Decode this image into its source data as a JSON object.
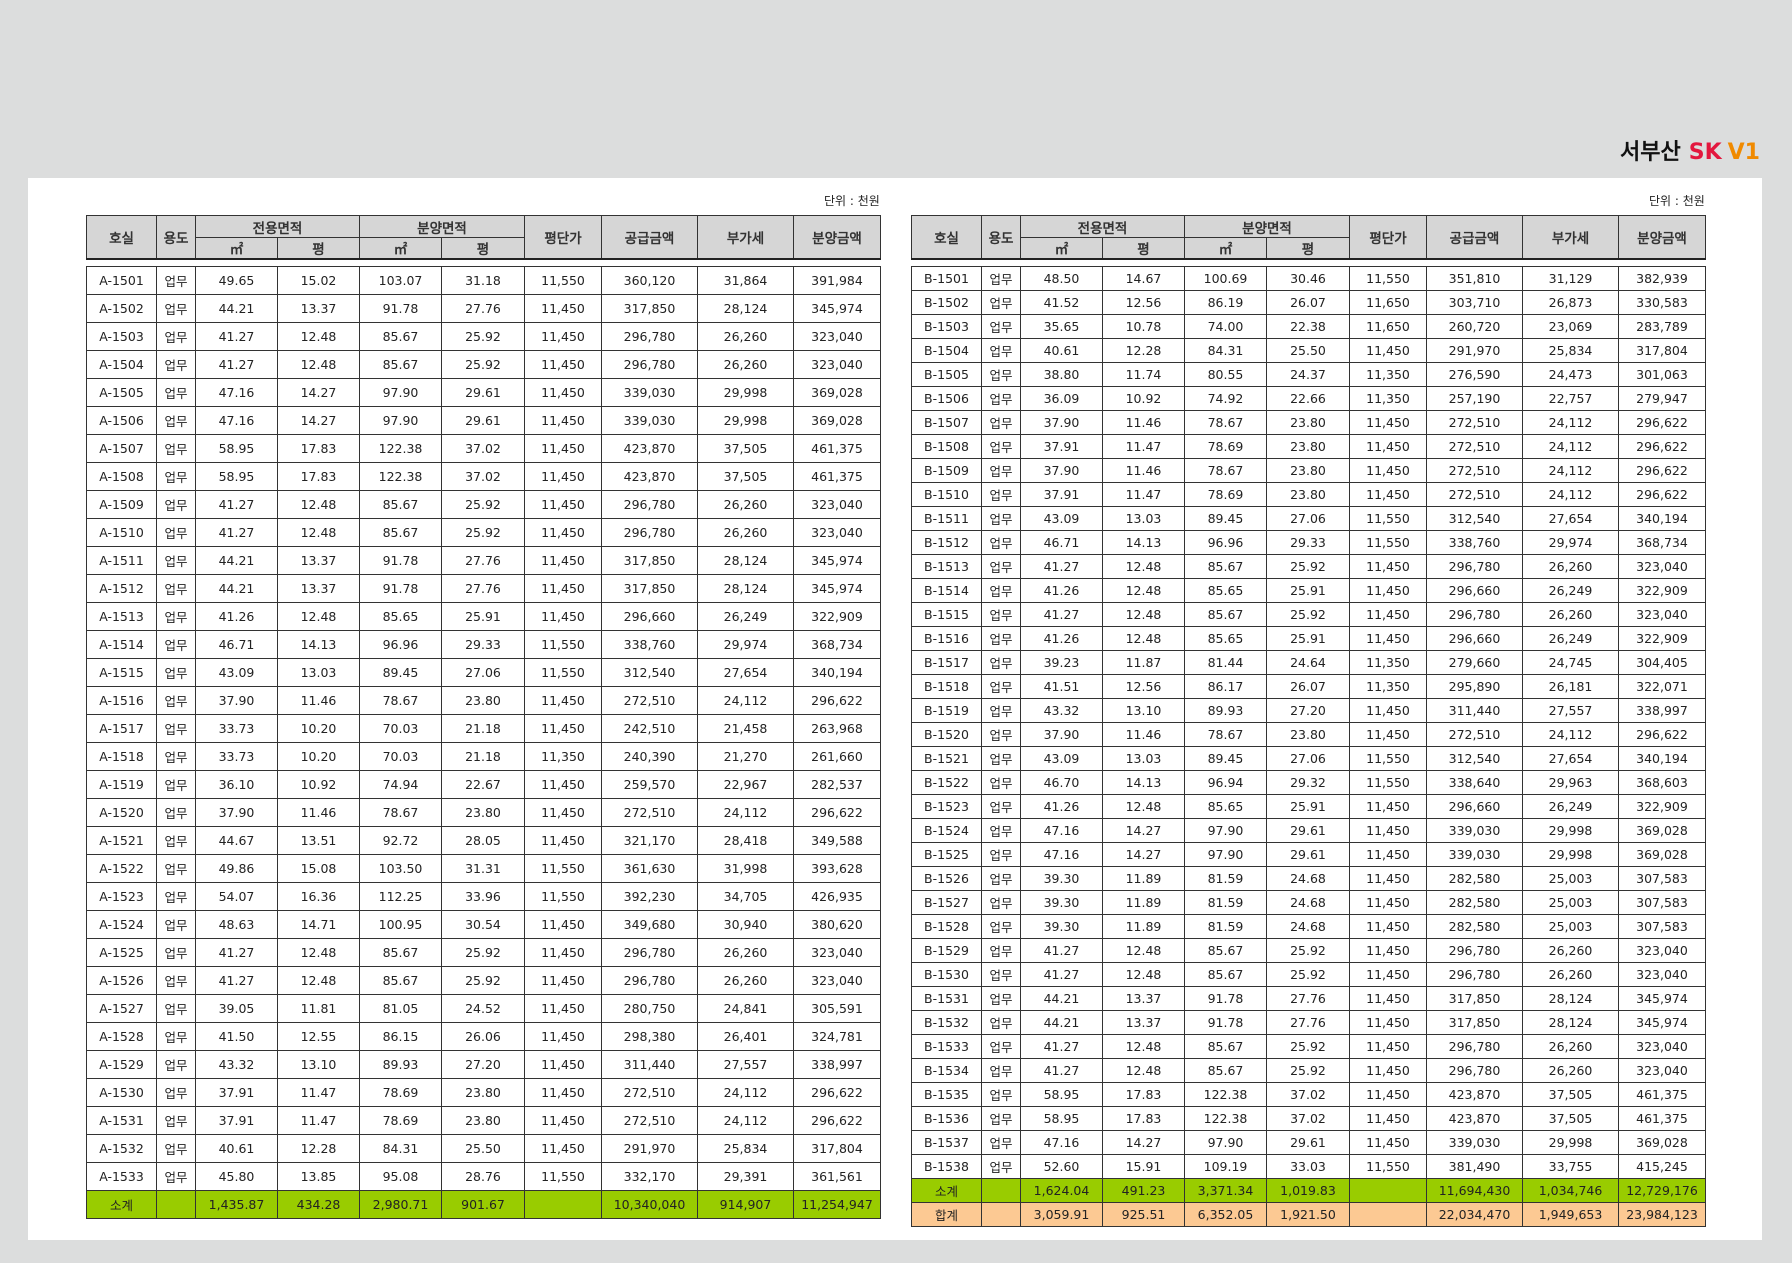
{
  "brand": {
    "prefix": "서부산",
    "sk": "SK",
    "v1": "V1",
    "colors": {
      "sk": "#e3173e",
      "v1": "#f08a00"
    }
  },
  "unit_label": "단위 : 천원",
  "headers": {
    "unit": "호실",
    "use": "용도",
    "exclusive": "전용면적",
    "sale_area": "분양면적",
    "m2": "㎡",
    "pyeong": "평",
    "price_per_pyeong": "평단가",
    "supply": "공급금액",
    "vat": "부가세",
    "total": "분양금액"
  },
  "colors": {
    "subtotal": "#99cc00",
    "grand_total": "#fcc993",
    "header": "#d6d6d6"
  },
  "table_a": {
    "rows": [
      [
        "A-1501",
        "업무",
        "49.65",
        "15.02",
        "103.07",
        "31.18",
        "11,550",
        "360,120",
        "31,864",
        "391,984"
      ],
      [
        "A-1502",
        "업무",
        "44.21",
        "13.37",
        "91.78",
        "27.76",
        "11,450",
        "317,850",
        "28,124",
        "345,974"
      ],
      [
        "A-1503",
        "업무",
        "41.27",
        "12.48",
        "85.67",
        "25.92",
        "11,450",
        "296,780",
        "26,260",
        "323,040"
      ],
      [
        "A-1504",
        "업무",
        "41.27",
        "12.48",
        "85.67",
        "25.92",
        "11,450",
        "296,780",
        "26,260",
        "323,040"
      ],
      [
        "A-1505",
        "업무",
        "47.16",
        "14.27",
        "97.90",
        "29.61",
        "11,450",
        "339,030",
        "29,998",
        "369,028"
      ],
      [
        "A-1506",
        "업무",
        "47.16",
        "14.27",
        "97.90",
        "29.61",
        "11,450",
        "339,030",
        "29,998",
        "369,028"
      ],
      [
        "A-1507",
        "업무",
        "58.95",
        "17.83",
        "122.38",
        "37.02",
        "11,450",
        "423,870",
        "37,505",
        "461,375"
      ],
      [
        "A-1508",
        "업무",
        "58.95",
        "17.83",
        "122.38",
        "37.02",
        "11,450",
        "423,870",
        "37,505",
        "461,375"
      ],
      [
        "A-1509",
        "업무",
        "41.27",
        "12.48",
        "85.67",
        "25.92",
        "11,450",
        "296,780",
        "26,260",
        "323,040"
      ],
      [
        "A-1510",
        "업무",
        "41.27",
        "12.48",
        "85.67",
        "25.92",
        "11,450",
        "296,780",
        "26,260",
        "323,040"
      ],
      [
        "A-1511",
        "업무",
        "44.21",
        "13.37",
        "91.78",
        "27.76",
        "11,450",
        "317,850",
        "28,124",
        "345,974"
      ],
      [
        "A-1512",
        "업무",
        "44.21",
        "13.37",
        "91.78",
        "27.76",
        "11,450",
        "317,850",
        "28,124",
        "345,974"
      ],
      [
        "A-1513",
        "업무",
        "41.26",
        "12.48",
        "85.65",
        "25.91",
        "11,450",
        "296,660",
        "26,249",
        "322,909"
      ],
      [
        "A-1514",
        "업무",
        "46.71",
        "14.13",
        "96.96",
        "29.33",
        "11,550",
        "338,760",
        "29,974",
        "368,734"
      ],
      [
        "A-1515",
        "업무",
        "43.09",
        "13.03",
        "89.45",
        "27.06",
        "11,550",
        "312,540",
        "27,654",
        "340,194"
      ],
      [
        "A-1516",
        "업무",
        "37.90",
        "11.46",
        "78.67",
        "23.80",
        "11,450",
        "272,510",
        "24,112",
        "296,622"
      ],
      [
        "A-1517",
        "업무",
        "33.73",
        "10.20",
        "70.03",
        "21.18",
        "11,450",
        "242,510",
        "21,458",
        "263,968"
      ],
      [
        "A-1518",
        "업무",
        "33.73",
        "10.20",
        "70.03",
        "21.18",
        "11,350",
        "240,390",
        "21,270",
        "261,660"
      ],
      [
        "A-1519",
        "업무",
        "36.10",
        "10.92",
        "74.94",
        "22.67",
        "11,450",
        "259,570",
        "22,967",
        "282,537"
      ],
      [
        "A-1520",
        "업무",
        "37.90",
        "11.46",
        "78.67",
        "23.80",
        "11,450",
        "272,510",
        "24,112",
        "296,622"
      ],
      [
        "A-1521",
        "업무",
        "44.67",
        "13.51",
        "92.72",
        "28.05",
        "11,450",
        "321,170",
        "28,418",
        "349,588"
      ],
      [
        "A-1522",
        "업무",
        "49.86",
        "15.08",
        "103.50",
        "31.31",
        "11,550",
        "361,630",
        "31,998",
        "393,628"
      ],
      [
        "A-1523",
        "업무",
        "54.07",
        "16.36",
        "112.25",
        "33.96",
        "11,550",
        "392,230",
        "34,705",
        "426,935"
      ],
      [
        "A-1524",
        "업무",
        "48.63",
        "14.71",
        "100.95",
        "30.54",
        "11,450",
        "349,680",
        "30,940",
        "380,620"
      ],
      [
        "A-1525",
        "업무",
        "41.27",
        "12.48",
        "85.67",
        "25.92",
        "11,450",
        "296,780",
        "26,260",
        "323,040"
      ],
      [
        "A-1526",
        "업무",
        "41.27",
        "12.48",
        "85.67",
        "25.92",
        "11,450",
        "296,780",
        "26,260",
        "323,040"
      ],
      [
        "A-1527",
        "업무",
        "39.05",
        "11.81",
        "81.05",
        "24.52",
        "11,450",
        "280,750",
        "24,841",
        "305,591"
      ],
      [
        "A-1528",
        "업무",
        "41.50",
        "12.55",
        "86.15",
        "26.06",
        "11,450",
        "298,380",
        "26,401",
        "324,781"
      ],
      [
        "A-1529",
        "업무",
        "43.32",
        "13.10",
        "89.93",
        "27.20",
        "11,450",
        "311,440",
        "27,557",
        "338,997"
      ],
      [
        "A-1530",
        "업무",
        "37.91",
        "11.47",
        "78.69",
        "23.80",
        "11,450",
        "272,510",
        "24,112",
        "296,622"
      ],
      [
        "A-1531",
        "업무",
        "37.91",
        "11.47",
        "78.69",
        "23.80",
        "11,450",
        "272,510",
        "24,112",
        "296,622"
      ],
      [
        "A-1532",
        "업무",
        "40.61",
        "12.28",
        "84.31",
        "25.50",
        "11,450",
        "291,970",
        "25,834",
        "317,804"
      ],
      [
        "A-1533",
        "업무",
        "45.80",
        "13.85",
        "95.08",
        "28.76",
        "11,550",
        "332,170",
        "29,391",
        "361,561"
      ]
    ],
    "subtotal": [
      "소계",
      "",
      "1,435.87",
      "434.28",
      "2,980.71",
      "901.67",
      "",
      "10,340,040",
      "914,907",
      "11,254,947"
    ]
  },
  "table_b": {
    "rows": [
      [
        "B-1501",
        "업무",
        "48.50",
        "14.67",
        "100.69",
        "30.46",
        "11,550",
        "351,810",
        "31,129",
        "382,939"
      ],
      [
        "B-1502",
        "업무",
        "41.52",
        "12.56",
        "86.19",
        "26.07",
        "11,650",
        "303,710",
        "26,873",
        "330,583"
      ],
      [
        "B-1503",
        "업무",
        "35.65",
        "10.78",
        "74.00",
        "22.38",
        "11,650",
        "260,720",
        "23,069",
        "283,789"
      ],
      [
        "B-1504",
        "업무",
        "40.61",
        "12.28",
        "84.31",
        "25.50",
        "11,450",
        "291,970",
        "25,834",
        "317,804"
      ],
      [
        "B-1505",
        "업무",
        "38.80",
        "11.74",
        "80.55",
        "24.37",
        "11,350",
        "276,590",
        "24,473",
        "301,063"
      ],
      [
        "B-1506",
        "업무",
        "36.09",
        "10.92",
        "74.92",
        "22.66",
        "11,350",
        "257,190",
        "22,757",
        "279,947"
      ],
      [
        "B-1507",
        "업무",
        "37.90",
        "11.46",
        "78.67",
        "23.80",
        "11,450",
        "272,510",
        "24,112",
        "296,622"
      ],
      [
        "B-1508",
        "업무",
        "37.91",
        "11.47",
        "78.69",
        "23.80",
        "11,450",
        "272,510",
        "24,112",
        "296,622"
      ],
      [
        "B-1509",
        "업무",
        "37.90",
        "11.46",
        "78.67",
        "23.80",
        "11,450",
        "272,510",
        "24,112",
        "296,622"
      ],
      [
        "B-1510",
        "업무",
        "37.91",
        "11.47",
        "78.69",
        "23.80",
        "11,450",
        "272,510",
        "24,112",
        "296,622"
      ],
      [
        "B-1511",
        "업무",
        "43.09",
        "13.03",
        "89.45",
        "27.06",
        "11,550",
        "312,540",
        "27,654",
        "340,194"
      ],
      [
        "B-1512",
        "업무",
        "46.71",
        "14.13",
        "96.96",
        "29.33",
        "11,550",
        "338,760",
        "29,974",
        "368,734"
      ],
      [
        "B-1513",
        "업무",
        "41.27",
        "12.48",
        "85.67",
        "25.92",
        "11,450",
        "296,780",
        "26,260",
        "323,040"
      ],
      [
        "B-1514",
        "업무",
        "41.26",
        "12.48",
        "85.65",
        "25.91",
        "11,450",
        "296,660",
        "26,249",
        "322,909"
      ],
      [
        "B-1515",
        "업무",
        "41.27",
        "12.48",
        "85.67",
        "25.92",
        "11,450",
        "296,780",
        "26,260",
        "323,040"
      ],
      [
        "B-1516",
        "업무",
        "41.26",
        "12.48",
        "85.65",
        "25.91",
        "11,450",
        "296,660",
        "26,249",
        "322,909"
      ],
      [
        "B-1517",
        "업무",
        "39.23",
        "11.87",
        "81.44",
        "24.64",
        "11,350",
        "279,660",
        "24,745",
        "304,405"
      ],
      [
        "B-1518",
        "업무",
        "41.51",
        "12.56",
        "86.17",
        "26.07",
        "11,350",
        "295,890",
        "26,181",
        "322,071"
      ],
      [
        "B-1519",
        "업무",
        "43.32",
        "13.10",
        "89.93",
        "27.20",
        "11,450",
        "311,440",
        "27,557",
        "338,997"
      ],
      [
        "B-1520",
        "업무",
        "37.90",
        "11.46",
        "78.67",
        "23.80",
        "11,450",
        "272,510",
        "24,112",
        "296,622"
      ],
      [
        "B-1521",
        "업무",
        "43.09",
        "13.03",
        "89.45",
        "27.06",
        "11,550",
        "312,540",
        "27,654",
        "340,194"
      ],
      [
        "B-1522",
        "업무",
        "46.70",
        "14.13",
        "96.94",
        "29.32",
        "11,550",
        "338,640",
        "29,963",
        "368,603"
      ],
      [
        "B-1523",
        "업무",
        "41.26",
        "12.48",
        "85.65",
        "25.91",
        "11,450",
        "296,660",
        "26,249",
        "322,909"
      ],
      [
        "B-1524",
        "업무",
        "47.16",
        "14.27",
        "97.90",
        "29.61",
        "11,450",
        "339,030",
        "29,998",
        "369,028"
      ],
      [
        "B-1525",
        "업무",
        "47.16",
        "14.27",
        "97.90",
        "29.61",
        "11,450",
        "339,030",
        "29,998",
        "369,028"
      ],
      [
        "B-1526",
        "업무",
        "39.30",
        "11.89",
        "81.59",
        "24.68",
        "11,450",
        "282,580",
        "25,003",
        "307,583"
      ],
      [
        "B-1527",
        "업무",
        "39.30",
        "11.89",
        "81.59",
        "24.68",
        "11,450",
        "282,580",
        "25,003",
        "307,583"
      ],
      [
        "B-1528",
        "업무",
        "39.30",
        "11.89",
        "81.59",
        "24.68",
        "11,450",
        "282,580",
        "25,003",
        "307,583"
      ],
      [
        "B-1529",
        "업무",
        "41.27",
        "12.48",
        "85.67",
        "25.92",
        "11,450",
        "296,780",
        "26,260",
        "323,040"
      ],
      [
        "B-1530",
        "업무",
        "41.27",
        "12.48",
        "85.67",
        "25.92",
        "11,450",
        "296,780",
        "26,260",
        "323,040"
      ],
      [
        "B-1531",
        "업무",
        "44.21",
        "13.37",
        "91.78",
        "27.76",
        "11,450",
        "317,850",
        "28,124",
        "345,974"
      ],
      [
        "B-1532",
        "업무",
        "44.21",
        "13.37",
        "91.78",
        "27.76",
        "11,450",
        "317,850",
        "28,124",
        "345,974"
      ],
      [
        "B-1533",
        "업무",
        "41.27",
        "12.48",
        "85.67",
        "25.92",
        "11,450",
        "296,780",
        "26,260",
        "323,040"
      ],
      [
        "B-1534",
        "업무",
        "41.27",
        "12.48",
        "85.67",
        "25.92",
        "11,450",
        "296,780",
        "26,260",
        "323,040"
      ],
      [
        "B-1535",
        "업무",
        "58.95",
        "17.83",
        "122.38",
        "37.02",
        "11,450",
        "423,870",
        "37,505",
        "461,375"
      ],
      [
        "B-1536",
        "업무",
        "58.95",
        "17.83",
        "122.38",
        "37.02",
        "11,450",
        "423,870",
        "37,505",
        "461,375"
      ],
      [
        "B-1537",
        "업무",
        "47.16",
        "14.27",
        "97.90",
        "29.61",
        "11,450",
        "339,030",
        "29,998",
        "369,028"
      ],
      [
        "B-1538",
        "업무",
        "52.60",
        "15.91",
        "109.19",
        "33.03",
        "11,550",
        "381,490",
        "33,755",
        "415,245"
      ]
    ],
    "subtotal": [
      "소계",
      "",
      "1,624.04",
      "491.23",
      "3,371.34",
      "1,019.83",
      "",
      "11,694,430",
      "1,034,746",
      "12,729,176"
    ],
    "grand_total": [
      "합계",
      "",
      "3,059.91",
      "925.51",
      "6,352.05",
      "1,921.50",
      "",
      "22,034,470",
      "1,949,653",
      "23,984,123"
    ]
  }
}
